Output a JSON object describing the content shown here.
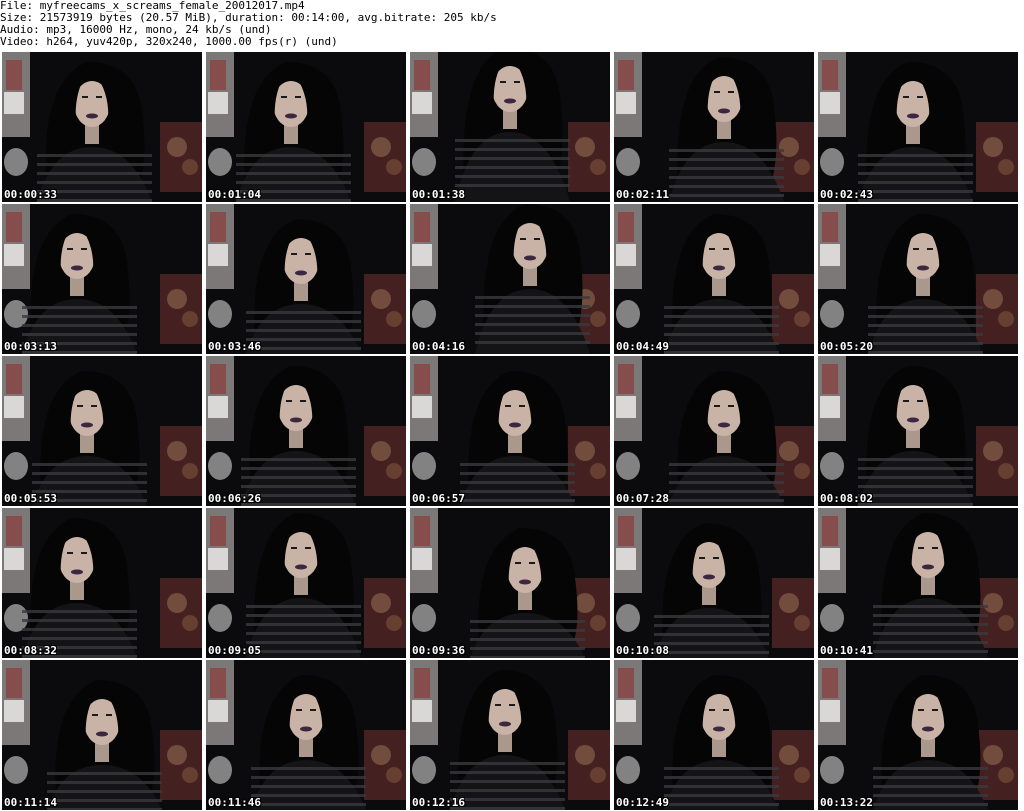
{
  "header": {
    "file_line": "File: myfreecams_x_screams_female_20012017.mp4",
    "size_line": "Size: 21573919 bytes (20.57 MiB), duration: 00:14:00, avg.bitrate: 205 kb/s",
    "audio_line": "Audio: mp3, 16000 Hz, mono, 24 kb/s (und)",
    "video_line": "Video: h264, yuv420p, 320x240, 1000.00 fps(r) (und)"
  },
  "thumbnails": [
    {
      "time": "00:00:33"
    },
    {
      "time": "00:01:04"
    },
    {
      "time": "00:01:38"
    },
    {
      "time": "00:02:11"
    },
    {
      "time": "00:02:43"
    },
    {
      "time": "00:03:13"
    },
    {
      "time": "00:03:46"
    },
    {
      "time": "00:04:16"
    },
    {
      "time": "00:04:49"
    },
    {
      "time": "00:05:20"
    },
    {
      "time": "00:05:53"
    },
    {
      "time": "00:06:26"
    },
    {
      "time": "00:06:57"
    },
    {
      "time": "00:07:28"
    },
    {
      "time": "00:08:02"
    },
    {
      "time": "00:08:32"
    },
    {
      "time": "00:09:05"
    },
    {
      "time": "00:09:36"
    },
    {
      "time": "00:10:08"
    },
    {
      "time": "00:10:41"
    },
    {
      "time": "00:11:14"
    },
    {
      "time": "00:11:46"
    },
    {
      "time": "00:12:16"
    },
    {
      "time": "00:12:49"
    },
    {
      "time": "00:13:22"
    }
  ],
  "colors": {
    "background": "#ffffff",
    "header_text": "#000000",
    "timestamp_text": "#ffffff",
    "frame_dark": "#0b0b0d",
    "skin": "#c9b3a6",
    "hair": "#050505",
    "stripe_light": "#3a3a3e",
    "lips": "#3b2740",
    "wall": "#d9d4cf",
    "blanket_red": "#8a3a3a"
  }
}
